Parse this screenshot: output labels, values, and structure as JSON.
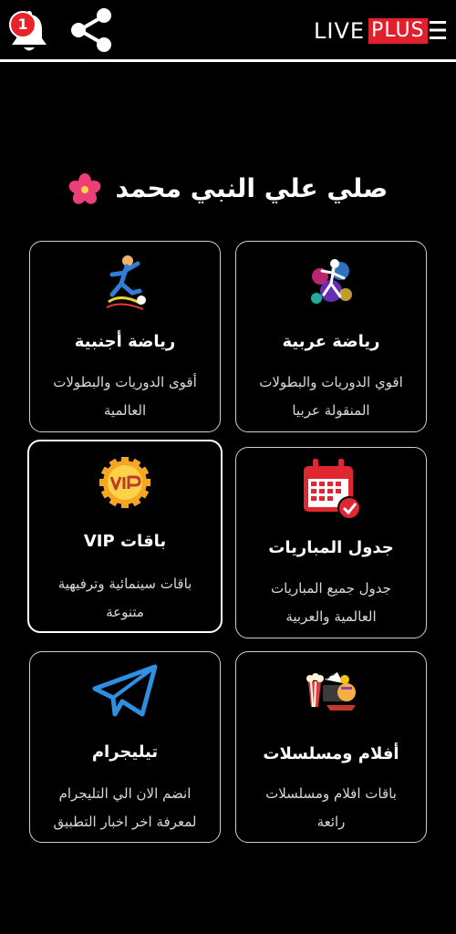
{
  "header": {
    "notification_count": "1",
    "brand_live": "LIVE",
    "brand_plus": "PLUS",
    "icons": [
      "bell-icon",
      "share-icon",
      "menu-icon"
    ],
    "accent_color": "#e0202c"
  },
  "blessing": {
    "text": "صلي علي النبي محمد",
    "emoji": "hibiscus-icon"
  },
  "cards": [
    {
      "title": "رياضة عربية",
      "desc_line1": "اقوي الدوريات والبطولات",
      "desc_line2": "المنقولة عربيا",
      "icon": "arabic-sports-icon"
    },
    {
      "title": "رياضة أجنبية",
      "desc_line1": "أقوى الدوريات والبطولات",
      "desc_line2": "العالمية",
      "icon": "foreign-sports-icon"
    },
    {
      "title": "جدول المباريات",
      "desc_line1": "جدول جميع المباريات",
      "desc_line2": "العالمية والعربية",
      "icon": "calendar-icon"
    },
    {
      "title": "باقات VIP",
      "desc_line1": "باقات سينمائية وترفيهية",
      "desc_line2": "متنوعة",
      "icon": "vip-badge-icon"
    },
    {
      "title": "أفلام ومسلسلات",
      "desc_line1": "باقات افلام ومسلسلات",
      "desc_line2": "رائعة",
      "icon": "movies-icon"
    },
    {
      "title": "تيليجرام",
      "desc_line1": "انضم الان الي التليجرام",
      "desc_line2": "لمعرفة اخر اخبار التطبيق",
      "icon": "telegram-icon"
    }
  ]
}
